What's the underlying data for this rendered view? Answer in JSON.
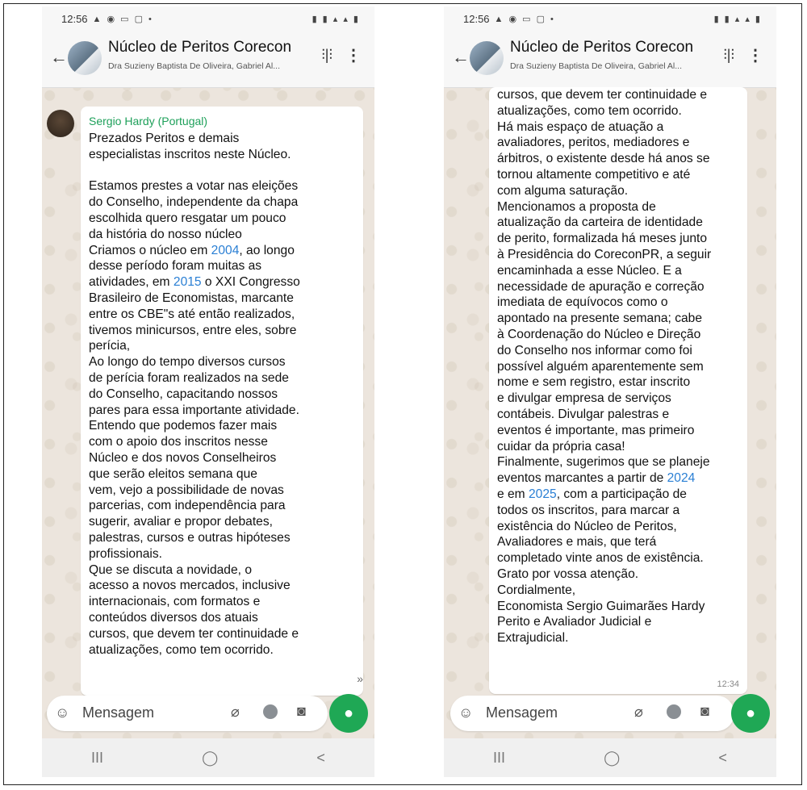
{
  "left_phone": {
    "status": {
      "time": "12:56",
      "left_icons": "▲ ◉ ▭ ▢ •",
      "right_icons": "▮ ▮ ▴ ▴ ▮"
    },
    "header": {
      "title": "Núcleo de Peritos Corecon",
      "subtitle": "Dra Suzieny Baptista De Oliveira, Gabriel Al..."
    },
    "message": {
      "sender": "Sergio Hardy (Portugal)",
      "lines": [
        "Prezados Peritos e demais",
        "especialistas inscritos neste Núcleo.",
        "",
        "Estamos prestes a votar nas eleições",
        "do Conselho, independente da chapa",
        "escolhida quero resgatar um pouco",
        "da história do nosso núcleo",
        "Criamos o núcleo em {2004}, ao longo",
        "desse período foram muitas as",
        "atividades, em {2015} o XXI Congresso",
        "Brasileiro de Economistas, marcante",
        "entre os CBE\"s até então realizados,",
        "tivemos minicursos, entre eles, sobre",
        "perícia,",
        "Ao longo do tempo diversos cursos",
        "de perícia foram realizados na sede",
        "do Conselho, capacitando nossos",
        "pares para essa importante atividade.",
        "Entendo que podemos fazer mais",
        "com o apoio dos inscritos nesse",
        "Núcleo e dos novos Conselheiros",
        "que serão eleitos semana que",
        "vem, vejo  a possibilidade de novas",
        "parcerias, com independência para",
        "sugerir, avaliar e propor debates,",
        "palestras, cursos e outras hipóteses",
        "profissionais.",
        "Que se discuta a novidade, o",
        "acesso a novos mercados, inclusive",
        "internacionais, com formatos e",
        "conteúdos diversos dos atuais",
        "cursos, que devem ter continuidade e",
        "atualizações, como tem ocorrido."
      ]
    },
    "composer": {
      "placeholder": "Mensagem"
    },
    "nav": {
      "recent": "III",
      "home": "◯",
      "back": "<"
    }
  },
  "right_phone": {
    "status": {
      "time": "12:56",
      "left_icons": "▲ ◉ ▭ ▢ •",
      "right_icons": "▮ ▮ ▴ ▴ ▮"
    },
    "header": {
      "title": "Núcleo de Peritos Corecon",
      "subtitle": "Dra Suzieny Baptista De Oliveira, Gabriel Al..."
    },
    "message": {
      "lines": [
        "cursos, que devem ter continuidade e",
        "atualizações, como tem ocorrido.",
        "Há mais espaço de atuação a",
        "avaliadores, peritos, mediadores e",
        "árbitros, o existente desde há anos se",
        "tornou altamente competitivo e até",
        "com alguma saturação.",
        "Mencionamos a proposta de",
        "atualização da carteira de identidade",
        "de perito, formalizada há meses junto",
        "à Presidência do CoreconPR, a seguir",
        "encaminhada a esse Núcleo. E a",
        "necessidade de apuração e correção",
        "imediata de equívocos como o",
        "apontado na presente semana; cabe",
        "à Coordenação do Núcleo e Direção",
        "do Conselho nos informar como foi",
        "possível alguém aparentemente sem",
        "nome e sem registro, estar inscrito",
        "e divulgar empresa de serviços",
        "contábeis. Divulgar palestras e",
        "eventos é importante, mas primeiro",
        "cuidar da própria casa!",
        "Finalmente, sugerimos que se planeje",
        "eventos marcantes a partir de {2024}",
        "e em {2025}, com a participação de",
        "todos os inscritos, para marcar a",
        "existência do Núcleo de Peritos,",
        "Avaliadores e mais, que terá",
        "completado vinte anos de existência.",
        "Grato por vossa atenção.",
        "Cordialmente,",
        "Economista Sergio Guimarães Hardy",
        "Perito e Avaliador Judicial e",
        "Extrajudicial."
      ],
      "time": "12:34"
    },
    "composer": {
      "placeholder": "Mensagem"
    },
    "nav": {
      "recent": "III",
      "home": "◯",
      "back": "<"
    }
  }
}
